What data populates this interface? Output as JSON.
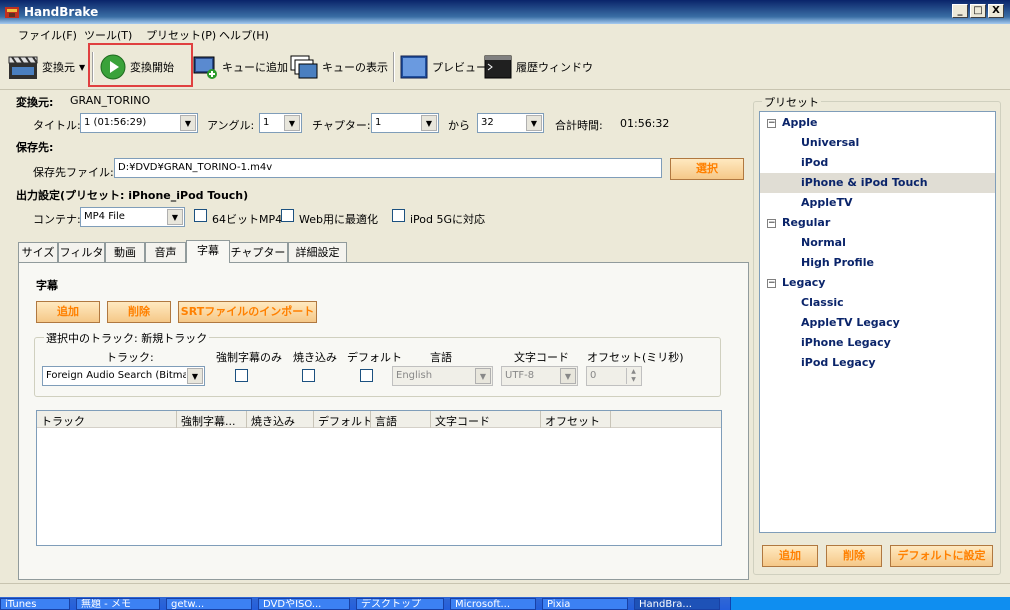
{
  "window": {
    "title": "HandBrake",
    "buttons": [
      "_",
      "□",
      "X"
    ]
  },
  "menu": [
    "ファイル(F)",
    "ツール(T)",
    "プリセット(P)",
    "ヘルプ(H)"
  ],
  "toolbar": {
    "source": "変換元",
    "start": "変換開始",
    "add_queue": "キューに追加",
    "show_queue": "キューの表示",
    "preview": "プレビュー",
    "activity": "履歴ウィンドウ"
  },
  "source": {
    "label": "変換元:",
    "name": "GRAN_TORINO",
    "title_label": "タイトル:",
    "title_value": "1 (01:56:29)",
    "angle_label": "アングル:",
    "angle_value": "1",
    "chapter_label": "チャプター:",
    "chapter_from": "1",
    "to_label": "から",
    "chapter_to": "32",
    "duration_label": "合計時間:",
    "duration_value": "01:56:32"
  },
  "destination": {
    "section": "保存先:",
    "file_label": "保存先ファイル:",
    "file_value": "D:¥DVD¥GRAN_TORINO-1.m4v",
    "browse": "選択"
  },
  "output": {
    "section": "出力設定(プリセット: iPhone_iPod Touch)",
    "container_label": "コンテナ:",
    "container_value": "MP4 File",
    "opt_64bit": "64ビットMP4",
    "opt_web": "Web用に最適化",
    "opt_ipod": "iPod 5Gに対応"
  },
  "tabs": [
    "サイズ",
    "フィルタ",
    "動画",
    "音声",
    "字幕",
    "チャプター",
    "詳細設定"
  ],
  "subtitles": {
    "heading": "字幕",
    "add": "追加",
    "remove": "削除",
    "import_srt": "SRTファイルのインポート",
    "group_title": "選択中のトラック: 新規トラック",
    "track_label": "トラック:",
    "forced_label": "強制字幕のみ",
    "burn_label": "焼き込み",
    "default_label": "デフォルト",
    "lang_label": "言語",
    "charset_label": "文字コード",
    "offset_label": "オフセット(ミリ秒)",
    "track_value": "Foreign Audio Search (Bitmap)",
    "lang_value": "English",
    "charset_value": "UTF-8",
    "offset_value": "0",
    "columns": [
      "トラック",
      "強制字幕...",
      "焼き込み",
      "デフォルト",
      "言語",
      "文字コード",
      "オフセット"
    ]
  },
  "presets": {
    "title": "プリセット",
    "groups": [
      {
        "name": "Apple",
        "items": [
          "Universal",
          "iPod",
          "iPhone & iPod Touch",
          "AppleTV"
        ]
      },
      {
        "name": "Regular",
        "items": [
          "Normal",
          "High Profile"
        ]
      },
      {
        "name": "Legacy",
        "items": [
          "Classic",
          "AppleTV Legacy",
          "iPhone Legacy",
          "iPod Legacy"
        ]
      }
    ],
    "selected": "iPhone & iPod Touch",
    "add": "追加",
    "remove": "削除",
    "set_default": "デフォルトに設定"
  },
  "taskbar": {
    "tasks": [
      "iTunes",
      "無題 - メモ",
      "getw...",
      "DVDやISO...",
      "デスクトップ",
      "Microsoft...",
      "Pixia",
      "HandBra..."
    ],
    "active": "HandBra..."
  }
}
